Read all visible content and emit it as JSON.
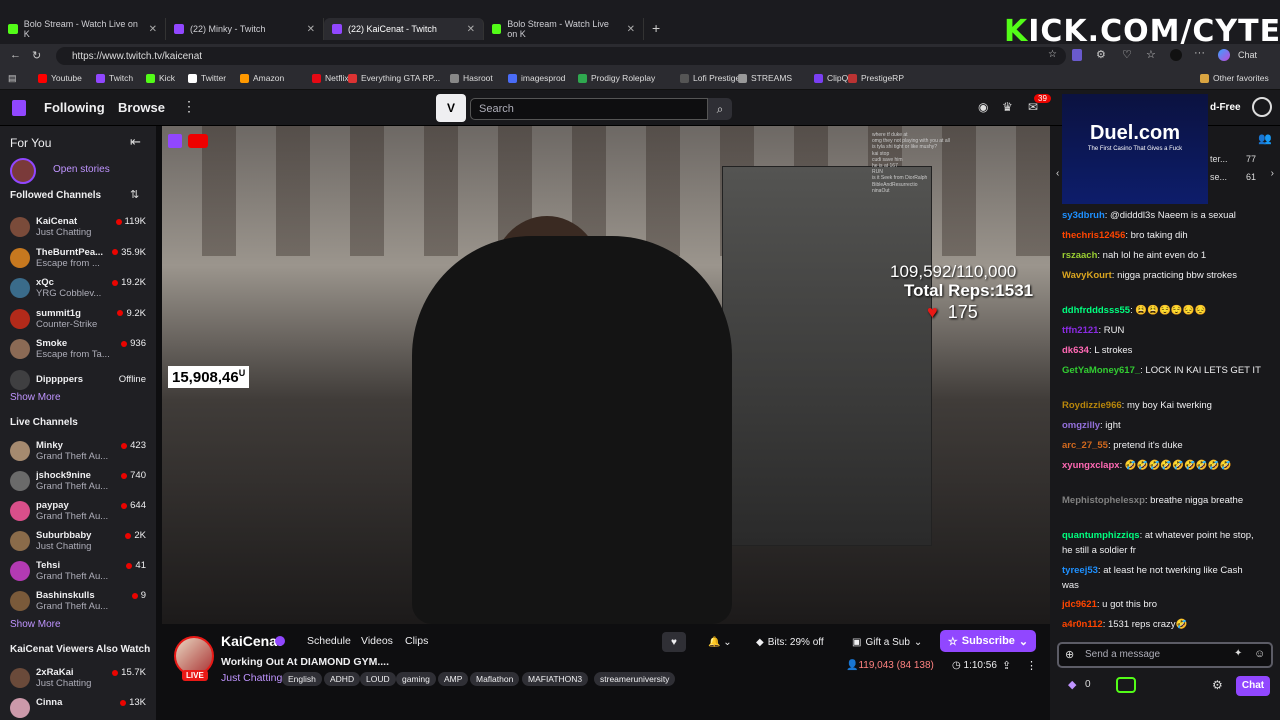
{
  "browser": {
    "tabs": [
      {
        "title": "Bolo Stream - Watch Live on K",
        "color": "#53fc18",
        "active": false
      },
      {
        "title": "(22) Minky - Twitch",
        "color": "#9147ff",
        "active": false
      },
      {
        "title": "(22) KaiCenat - Twitch",
        "color": "#9147ff",
        "active": true
      },
      {
        "title": "Bolo Stream - Watch Live on K",
        "color": "#53fc18",
        "active": false
      }
    ],
    "url": "https://www.twitch.tv/kaicenat",
    "overlay_banner_k": "K",
    "overlay_banner_rest": "ICK.COM/CYTER",
    "copilot_label": "Chat",
    "bookmarks": [
      {
        "label": "Youtube",
        "color": "#ff0000"
      },
      {
        "label": "Twitch",
        "color": "#9147ff"
      },
      {
        "label": "Kick",
        "color": "#53fc18"
      },
      {
        "label": "Twitter",
        "color": "#ffffff"
      },
      {
        "label": "Amazon",
        "color": "#ff9900"
      },
      {
        "label": "Netflix",
        "color": "#e50914"
      },
      {
        "label": "Everything GTA RP...",
        "color": "#d33"
      },
      {
        "label": "Hasroot",
        "color": "#888"
      },
      {
        "label": "imagesprod",
        "color": "#4a6cf7"
      },
      {
        "label": "Prodigy Roleplay",
        "color": "#2fa84f"
      },
      {
        "label": "Lofi Prestige",
        "color": "#555"
      },
      {
        "label": "STREAMS",
        "color": "#999"
      },
      {
        "label": "ClipQ",
        "color": "#7a3ff2"
      },
      {
        "label": "PrestigeRP",
        "color": "#b33"
      }
    ],
    "other_favorites": "Other favorites"
  },
  "topnav": {
    "following": "Following",
    "browse": "Browse",
    "search_placeholder": "Search",
    "notif_count": "39",
    "ad_free": "d-Free"
  },
  "sidebar": {
    "for_you": "For You",
    "open_stories": "Open stories",
    "followed_header": "Followed Channels",
    "followed": [
      {
        "name": "KaiCenat",
        "game": "Just Chatting",
        "viewers": "119K",
        "avatar": "#7a4b3a"
      },
      {
        "name": "TheBurntPea...",
        "game": "Escape from ...",
        "viewers": "35.9K",
        "avatar": "#c6781f"
      },
      {
        "name": "xQc",
        "game": "YRG Cobblev...",
        "viewers": "19.2K",
        "avatar": "#3a6b8a"
      },
      {
        "name": "summit1g",
        "game": "Counter-Strike",
        "viewers": "9.2K",
        "avatar": "#b22a1a"
      },
      {
        "name": "Smoke",
        "game": "Escape from Ta...",
        "viewers": "936",
        "avatar": "#8b6a55"
      },
      {
        "name": "Dippppers",
        "game": "",
        "viewers": "Offline",
        "avatar": "#555"
      }
    ],
    "show_more_1": "Show More",
    "live_header": "Live Channels",
    "live": [
      {
        "name": "Minky",
        "game": "Grand Theft Au...",
        "viewers": "423",
        "avatar": "#a58a6f"
      },
      {
        "name": "jshock9nine",
        "game": "Grand Theft Au...",
        "viewers": "740",
        "avatar": "#6a6a6a"
      },
      {
        "name": "paypay",
        "game": "Grand Theft Au...",
        "viewers": "644",
        "avatar": "#d94f8a"
      },
      {
        "name": "Suburbbaby",
        "game": "Just Chatting",
        "viewers": "2K",
        "avatar": "#8a6b4a"
      },
      {
        "name": "Tehsi",
        "game": "Grand Theft Au...",
        "viewers": "41",
        "avatar": "#b33ab3"
      },
      {
        "name": "Bashinskulls",
        "game": "Grand Theft Au...",
        "viewers": "9",
        "avatar": "#7a5a3a"
      }
    ],
    "show_more_2": "Show More",
    "also_watch_header": "KaiCenat Viewers Also Watch",
    "also_watch": [
      {
        "name": "2xRaKai",
        "game": "Just Chatting",
        "viewers": "15.7K",
        "avatar": "#6a4a3a"
      },
      {
        "name": "Cinna",
        "game": "",
        "viewers": "13K",
        "avatar": "#c9a"
      }
    ]
  },
  "video": {
    "reps_count": "109,592/110,000",
    "total_reps": "Total Reps:1531",
    "heart_rate": "175",
    "counter": "15,908,46",
    "counter_sup": "U",
    "overlay_chat": [
      "where tf duke at",
      "omg they not playing with you at all",
      "is tyla shi tight or like mushy?",
      "kai stop",
      "cudi save him",
      "he is at 167",
      "RUN",
      "is it Seek from DiorRalph",
      "BibleAndResurrectio",
      "ninaOut"
    ]
  },
  "stream": {
    "channel": "KaiCenat",
    "tabs": [
      "Schedule",
      "Videos",
      "Clips"
    ],
    "title": "Working Out At DIAMOND GYM....",
    "category": "Just Chatting",
    "tags": [
      "English",
      "ADHD",
      "LOUD",
      "gaming",
      "AMP",
      "Maflathon",
      "MAFIATHON3",
      "streameruniversity"
    ],
    "live": "LIVE",
    "bits": "Bits: 29% off",
    "gift": "Gift a Sub",
    "subscribe": "Subscribe",
    "viewers": "119,043 (84 138)",
    "uptime": "1:10:56"
  },
  "chat": {
    "ad_brand": "Duel.com",
    "ad_tagline": "The First Casino That Gives a Fuck",
    "leader_counts": [
      "77",
      "61"
    ],
    "leader_names": [
      "ter...",
      "se..."
    ],
    "messages": [
      {
        "user": "sy3dbruh",
        "color": "#1e90ff",
        "text": ": @didddl3s Naeem is a sexual"
      },
      {
        "user": "thechris12456",
        "color": "#ff4500",
        "text": ": bro taking dih"
      },
      {
        "user": "rszaach",
        "color": "#9acd32",
        "text": ": nah lol he aint even do 1"
      },
      {
        "user": "WavyKourt",
        "color": "#daa520",
        "text": ": nigga practicing bbw strokes"
      },
      {
        "user": "ddhfrdddsss55",
        "color": "#00ff7f",
        "text": ": 😩😩😌😌😔😔"
      },
      {
        "user": "tffn2121",
        "color": "#8a2be2",
        "text": ": RUN"
      },
      {
        "user": "dk634",
        "color": "#ff69b4",
        "text": ": L strokes"
      },
      {
        "user": "GetYaMoney617_",
        "color": "#32cd32",
        "text": ": LOCK IN KAI LETS GET IT"
      },
      {
        "user": "Roydizzie966",
        "color": "#b8860b",
        "text": ": my boy Kai twerking"
      },
      {
        "user": "omgzilly",
        "color": "#9370db",
        "text": ": ight"
      },
      {
        "user": "arc_27_55",
        "color": "#d2691e",
        "text": ": pretend it's duke"
      },
      {
        "user": "xyungxclapx",
        "color": "#ff69b4",
        "text": ": 🤣🤣🤣🤣🤣🤣🤣🤣🤣"
      },
      {
        "user": "Mephistophelesxp",
        "color": "#808080",
        "text": ": breathe nigga breathe"
      },
      {
        "user": "quantumphizziqs",
        "color": "#00ff7f",
        "text": ": at whatever point he stop, he still a soldier fr"
      },
      {
        "user": "tyreej53",
        "color": "#1e90ff",
        "text": ": at least he not twerking like Cash was"
      },
      {
        "user": "jdc9621",
        "color": "#ff4500",
        "text": ": u got this bro"
      },
      {
        "user": "a4r0n112",
        "color": "#ff4500",
        "text": ": 1531 reps crazy🤣"
      }
    ],
    "input_placeholder": "Send a message",
    "points": "0",
    "chat_button": "Chat"
  }
}
